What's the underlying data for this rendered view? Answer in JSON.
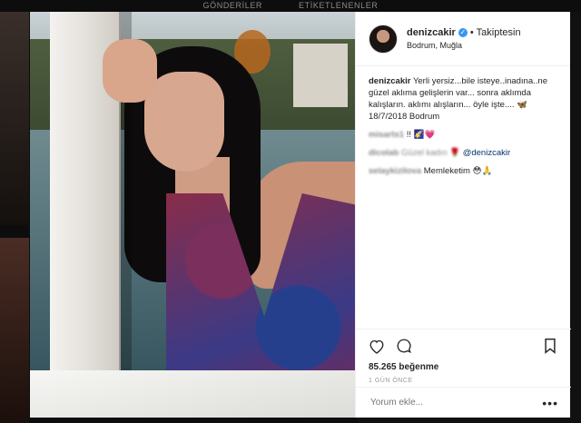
{
  "background": {
    "tabs": [
      {
        "label": "GÖNDERİLER"
      },
      {
        "label": "ETİKETLENENLER"
      }
    ]
  },
  "post": {
    "header": {
      "username": "denizcakir",
      "follow_status": "Takiptesin",
      "location": "Bodrum, Muğla"
    },
    "caption": {
      "username": "denizcakir",
      "text": "Yerli yersiz...bile isteye..inadına..ne güzel aklıma gelişlerin var... sonra aklımda kalışların. aklımı alışların... öyle işte.... 🦋 18/7/2018 Bodrum"
    },
    "comments": [
      {
        "username": "misarts1",
        "text": "!! 🌠💗"
      },
      {
        "username": "dicolab",
        "text": "Güzel kadın 🌹",
        "mention": "@denizcakir"
      },
      {
        "username": "selaykizilova",
        "text": "Memleketim 😳🙏"
      }
    ],
    "likes": "85.265 beğenme",
    "time_ago": "1 GÜN ÖNCE",
    "comment_placeholder": "Yorum ekle...",
    "more_label": "•••"
  },
  "icons": {
    "like": "heart-icon",
    "comment": "comment-icon",
    "save": "bookmark-icon",
    "verified": "verified-badge-icon"
  },
  "colors": {
    "verified": "#3897f0",
    "mention": "#003569",
    "text": "#262626",
    "muted": "#999999"
  }
}
